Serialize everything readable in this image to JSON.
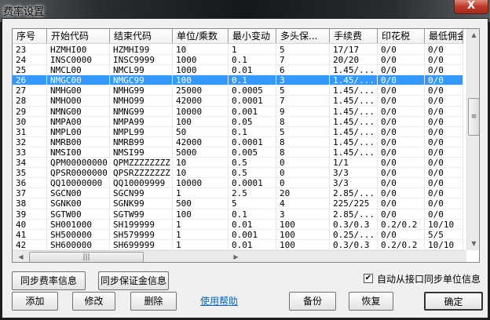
{
  "window": {
    "title": "费率设置",
    "close": "X"
  },
  "table": {
    "headers": [
      "序号",
      "开始代码",
      "结束代码",
      "单位/乘数",
      "最小变动",
      "多头保...",
      "手续费",
      "印花税",
      "最低佣金"
    ],
    "selected_index": 3,
    "rows": [
      [
        "23",
        "HZMHI00",
        "HZMHI99",
        "10",
        "1",
        "5",
        "17/17",
        "0/0",
        "0/0"
      ],
      [
        "24",
        "INSC0000",
        "INSC9999",
        "1000",
        "0.1",
        "7",
        "20/20",
        "0/0",
        "0/0"
      ],
      [
        "25",
        "NMCL00",
        "NMCL99",
        "1000",
        "0.01",
        "6",
        "1.45/...",
        "0/0",
        "0/0"
      ],
      [
        "26",
        "NMGC00",
        "NMGC99",
        "100",
        "0.1",
        "3",
        "1.45/...",
        "0/0",
        "0/0"
      ],
      [
        "27",
        "NMHG00",
        "NMHG99",
        "25000",
        "0.0005",
        "5",
        "1.45/...",
        "0/0",
        "0/0"
      ],
      [
        "28",
        "NMHO00",
        "NMHO99",
        "42000",
        "0.0001",
        "7",
        "1.45/...",
        "0/0",
        "0/0"
      ],
      [
        "29",
        "NMNG00",
        "NMNG99",
        "10000",
        "0.001",
        "9",
        "1.45/...",
        "0/0",
        "0/0"
      ],
      [
        "30",
        "NMPA00",
        "NMPA99",
        "100",
        "0.05",
        "8",
        "1.45/...",
        "0/0",
        "0/0"
      ],
      [
        "31",
        "NMPL00",
        "NMPL99",
        "50",
        "0.1",
        "5",
        "1.45/...",
        "0/0",
        "0/0"
      ],
      [
        "32",
        "NMRB00",
        "NMRB99",
        "42000",
        "0.0001",
        "8",
        "1.45/...",
        "0/0",
        "0/0"
      ],
      [
        "33",
        "NMSI00",
        "NMSI99",
        "5000",
        "0.005",
        "8",
        "1.45/...",
        "0/0",
        "0/0"
      ],
      [
        "34",
        "QPM00000000",
        "QPMZZZZZZZZ",
        "10",
        "0.5",
        "0",
        "1/1",
        "0/0",
        "0/0"
      ],
      [
        "35",
        "QPSR0000000",
        "QPSRZZZZZZZ",
        "10",
        "0.5",
        "0",
        "3/3",
        "0/0",
        "0/0"
      ],
      [
        "36",
        "QQ10000000",
        "QQ10009999",
        "10000",
        "0.0001",
        "0",
        "3/3",
        "0/0",
        "0/0"
      ],
      [
        "37",
        "SGCN00",
        "SGCN99",
        "1",
        "2.5",
        "20",
        "2.85/...",
        "0/0",
        "0/0"
      ],
      [
        "38",
        "SGNK00",
        "SGNK99",
        "500",
        "5",
        "4",
        "225/225",
        "0/0",
        "0/0"
      ],
      [
        "39",
        "SGTW00",
        "SGTW99",
        "100",
        "0.1",
        "3",
        "2.85/...",
        "0/0",
        "0/0"
      ],
      [
        "40",
        "SH001000",
        "SH199999",
        "1",
        "0.01",
        "100",
        "0.3/0.3",
        "0.2/0.2",
        "10/10"
      ],
      [
        "41",
        "SH500000",
        "SH579999",
        "1",
        "0.001",
        "100",
        "0.25/...",
        "0/0",
        "5/5"
      ],
      [
        "42",
        "SH600000",
        "SH699999",
        "1",
        "0.01",
        "100",
        "0.3/0.3",
        "0.2/0.2",
        "10/10"
      ]
    ]
  },
  "buttons": {
    "sync_rate": "同步费率信息",
    "sync_margin": "同步保证金信息",
    "add": "添加",
    "edit": "修改",
    "delete": "删除",
    "help": "使用帮助",
    "backup": "备份",
    "restore": "恢复",
    "ok": "确定"
  },
  "auto_sync": {
    "label": "自动从接口同步单位信息",
    "checked": true
  }
}
